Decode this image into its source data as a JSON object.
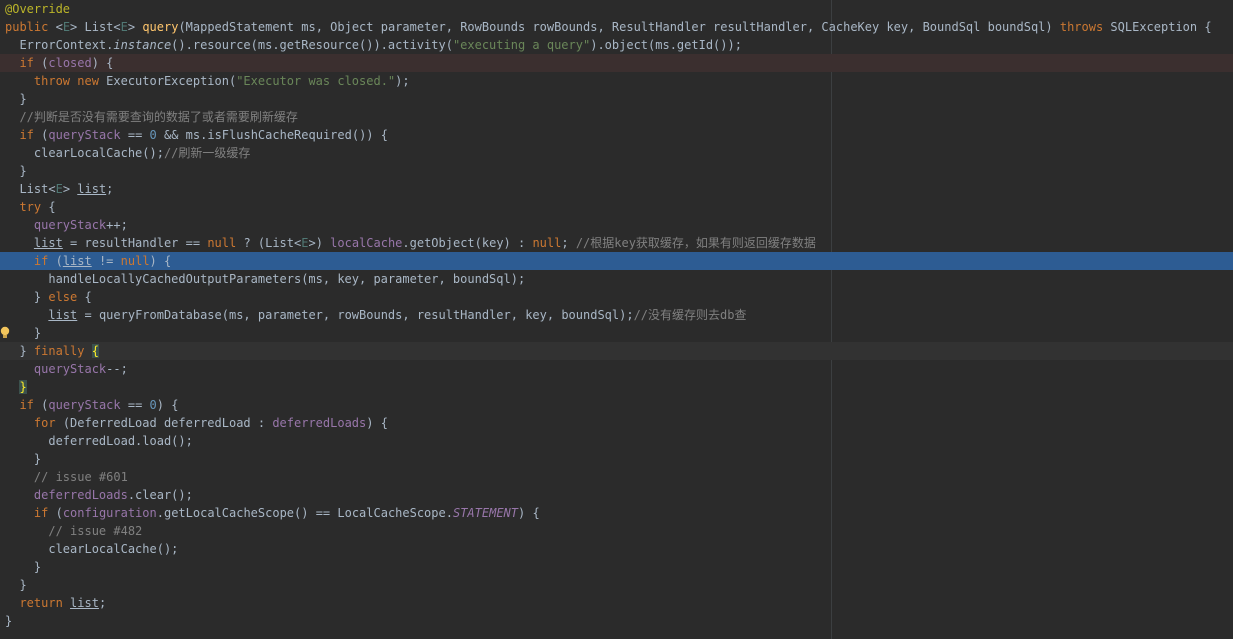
{
  "editor": {
    "colors": {
      "background": "#2b2b2b",
      "keyword": "#cc7832",
      "method": "#ffc66d",
      "field": "#9876aa",
      "string": "#6a8759",
      "number": "#6897bb",
      "comment": "#808080",
      "annotation": "#bbb529",
      "selected_line": "#2d5c93"
    },
    "gutter_icon": "lightbulb-icon",
    "lines": [
      {
        "hl": "",
        "tokens": [
          {
            "t": "@Override",
            "c": "annotation"
          }
        ]
      },
      {
        "hl": "",
        "tokens": [
          {
            "t": "public ",
            "c": "keyword"
          },
          {
            "t": "<",
            "c": "plain"
          },
          {
            "t": "E",
            "c": "generic"
          },
          {
            "t": "> List<",
            "c": "plain"
          },
          {
            "t": "E",
            "c": "generic"
          },
          {
            "t": "> ",
            "c": "plain"
          },
          {
            "t": "query",
            "c": "method"
          },
          {
            "t": "(MappedStatement ms, Object parameter, RowBounds rowBounds, ResultHandler resultHandler, CacheKey key, BoundSql boundSql) ",
            "c": "plain"
          },
          {
            "t": "throws ",
            "c": "keyword"
          },
          {
            "t": "SQLException {",
            "c": "plain"
          }
        ]
      },
      {
        "hl": "",
        "tokens": [
          {
            "t": "  ErrorContext.",
            "c": "plain"
          },
          {
            "t": "instance",
            "c": "italic-method"
          },
          {
            "t": "().resource(ms.getResource()).activity(",
            "c": "plain"
          },
          {
            "t": "\"executing a query\"",
            "c": "string"
          },
          {
            "t": ").object(ms.getId());",
            "c": "plain"
          }
        ]
      },
      {
        "hl": "error",
        "tokens": [
          {
            "t": "  ",
            "c": "plain"
          },
          {
            "t": "if ",
            "c": "keyword"
          },
          {
            "t": "(",
            "c": "plain"
          },
          {
            "t": "closed",
            "c": "field"
          },
          {
            "t": ") {",
            "c": "plain"
          }
        ]
      },
      {
        "hl": "",
        "tokens": [
          {
            "t": "    ",
            "c": "plain"
          },
          {
            "t": "throw new ",
            "c": "keyword"
          },
          {
            "t": "ExecutorException(",
            "c": "plain"
          },
          {
            "t": "\"Executor was closed.\"",
            "c": "string"
          },
          {
            "t": ");",
            "c": "plain"
          }
        ]
      },
      {
        "hl": "",
        "tokens": [
          {
            "t": "  }",
            "c": "plain"
          }
        ]
      },
      {
        "hl": "",
        "tokens": [
          {
            "t": "  //判断是否没有需要查询的数据了或者需要刷新缓存",
            "c": "comment"
          }
        ]
      },
      {
        "hl": "",
        "tokens": [
          {
            "t": "  ",
            "c": "plain"
          },
          {
            "t": "if ",
            "c": "keyword"
          },
          {
            "t": "(",
            "c": "plain"
          },
          {
            "t": "queryStack ",
            "c": "field"
          },
          {
            "t": "== ",
            "c": "plain"
          },
          {
            "t": "0 ",
            "c": "number"
          },
          {
            "t": "&& ms.isFlushCacheRequired()) {",
            "c": "plain"
          }
        ]
      },
      {
        "hl": "",
        "tokens": [
          {
            "t": "    clearLocalCache();",
            "c": "plain"
          },
          {
            "t": "//刷新一级缓存",
            "c": "comment"
          }
        ]
      },
      {
        "hl": "",
        "tokens": [
          {
            "t": "  }",
            "c": "plain"
          }
        ]
      },
      {
        "hl": "",
        "tokens": [
          {
            "t": "  List<",
            "c": "plain"
          },
          {
            "t": "E",
            "c": "generic"
          },
          {
            "t": "> ",
            "c": "plain"
          },
          {
            "t": "list",
            "c": "underline"
          },
          {
            "t": ";",
            "c": "plain"
          }
        ]
      },
      {
        "hl": "",
        "tokens": [
          {
            "t": "  ",
            "c": "plain"
          },
          {
            "t": "try ",
            "c": "keyword"
          },
          {
            "t": "{",
            "c": "plain"
          }
        ]
      },
      {
        "hl": "",
        "tokens": [
          {
            "t": "    ",
            "c": "plain"
          },
          {
            "t": "queryStack",
            "c": "field"
          },
          {
            "t": "++;",
            "c": "plain"
          }
        ]
      },
      {
        "hl": "",
        "tokens": [
          {
            "t": "    ",
            "c": "plain"
          },
          {
            "t": "list",
            "c": "underline"
          },
          {
            "t": " = resultHandler == ",
            "c": "plain"
          },
          {
            "t": "null ",
            "c": "keyword"
          },
          {
            "t": "? (List<",
            "c": "plain"
          },
          {
            "t": "E",
            "c": "generic"
          },
          {
            "t": ">) ",
            "c": "plain"
          },
          {
            "t": "localCache",
            "c": "field"
          },
          {
            "t": ".getObject(key) : ",
            "c": "plain"
          },
          {
            "t": "null",
            "c": "keyword"
          },
          {
            "t": "; ",
            "c": "plain"
          },
          {
            "t": "//根据key获取缓存，如果有则返回缓存数据",
            "c": "comment"
          }
        ]
      },
      {
        "hl": "selected",
        "tokens": [
          {
            "t": "    ",
            "c": "plain"
          },
          {
            "t": "if ",
            "c": "keyword"
          },
          {
            "t": "(",
            "c": "plain"
          },
          {
            "t": "list",
            "c": "underline"
          },
          {
            "t": " != ",
            "c": "plain"
          },
          {
            "t": "null",
            "c": "keyword"
          },
          {
            "t": ") {",
            "c": "plain"
          }
        ]
      },
      {
        "hl": "",
        "tokens": [
          {
            "t": "      handleLocallyCachedOutputParameters(ms, key, parameter, boundSql);",
            "c": "plain"
          }
        ]
      },
      {
        "hl": "",
        "tokens": [
          {
            "t": "    } ",
            "c": "plain"
          },
          {
            "t": "else ",
            "c": "keyword"
          },
          {
            "t": "{",
            "c": "plain"
          }
        ]
      },
      {
        "hl": "",
        "tokens": [
          {
            "t": "      ",
            "c": "plain"
          },
          {
            "t": "list",
            "c": "underline"
          },
          {
            "t": " = queryFromDatabase(ms, parameter, rowBounds, resultHandler, key, boundSql);",
            "c": "plain"
          },
          {
            "t": "//没有缓存则去db查",
            "c": "comment"
          }
        ]
      },
      {
        "hl": "",
        "bulb": true,
        "tokens": [
          {
            "t": "    }",
            "c": "plain"
          }
        ]
      },
      {
        "hl": "caret",
        "tokens": [
          {
            "t": "  } ",
            "c": "plain"
          },
          {
            "t": "finally ",
            "c": "keyword"
          },
          {
            "t": "{",
            "c": "brace-match"
          }
        ]
      },
      {
        "hl": "",
        "tokens": [
          {
            "t": "    ",
            "c": "plain"
          },
          {
            "t": "queryStack",
            "c": "field"
          },
          {
            "t": "--;",
            "c": "plain"
          }
        ]
      },
      {
        "hl": "",
        "tokens": [
          {
            "t": "  ",
            "c": "plain"
          },
          {
            "t": "}",
            "c": "brace-match"
          }
        ]
      },
      {
        "hl": "",
        "tokens": [
          {
            "t": "  ",
            "c": "plain"
          },
          {
            "t": "if ",
            "c": "keyword"
          },
          {
            "t": "(",
            "c": "plain"
          },
          {
            "t": "queryStack ",
            "c": "field"
          },
          {
            "t": "== ",
            "c": "plain"
          },
          {
            "t": "0",
            "c": "number"
          },
          {
            "t": ") {",
            "c": "plain"
          }
        ]
      },
      {
        "hl": "",
        "tokens": [
          {
            "t": "    ",
            "c": "plain"
          },
          {
            "t": "for ",
            "c": "keyword"
          },
          {
            "t": "(DeferredLoad deferredLoad : ",
            "c": "plain"
          },
          {
            "t": "deferredLoads",
            "c": "field"
          },
          {
            "t": ") {",
            "c": "plain"
          }
        ]
      },
      {
        "hl": "",
        "tokens": [
          {
            "t": "      deferredLoad.load();",
            "c": "plain"
          }
        ]
      },
      {
        "hl": "",
        "tokens": [
          {
            "t": "    }",
            "c": "plain"
          }
        ]
      },
      {
        "hl": "",
        "tokens": [
          {
            "t": "    // issue #601",
            "c": "comment"
          }
        ]
      },
      {
        "hl": "",
        "tokens": [
          {
            "t": "    ",
            "c": "plain"
          },
          {
            "t": "deferredLoads",
            "c": "field"
          },
          {
            "t": ".clear();",
            "c": "plain"
          }
        ]
      },
      {
        "hl": "",
        "tokens": [
          {
            "t": "    ",
            "c": "plain"
          },
          {
            "t": "if ",
            "c": "keyword"
          },
          {
            "t": "(",
            "c": "plain"
          },
          {
            "t": "configuration",
            "c": "field"
          },
          {
            "t": ".getLocalCacheScope() == LocalCacheScope.",
            "c": "plain"
          },
          {
            "t": "STATEMENT",
            "c": "italic-field"
          },
          {
            "t": ") {",
            "c": "plain"
          }
        ]
      },
      {
        "hl": "",
        "tokens": [
          {
            "t": "      // issue #482",
            "c": "comment"
          }
        ]
      },
      {
        "hl": "",
        "tokens": [
          {
            "t": "      clearLocalCache();",
            "c": "plain"
          }
        ]
      },
      {
        "hl": "",
        "tokens": [
          {
            "t": "    }",
            "c": "plain"
          }
        ]
      },
      {
        "hl": "",
        "tokens": [
          {
            "t": "  }",
            "c": "plain"
          }
        ]
      },
      {
        "hl": "",
        "tokens": [
          {
            "t": "  ",
            "c": "plain"
          },
          {
            "t": "return ",
            "c": "keyword"
          },
          {
            "t": "list",
            "c": "underline"
          },
          {
            "t": ";",
            "c": "plain"
          }
        ]
      },
      {
        "hl": "",
        "tokens": [
          {
            "t": "}",
            "c": "plain"
          }
        ]
      }
    ]
  }
}
